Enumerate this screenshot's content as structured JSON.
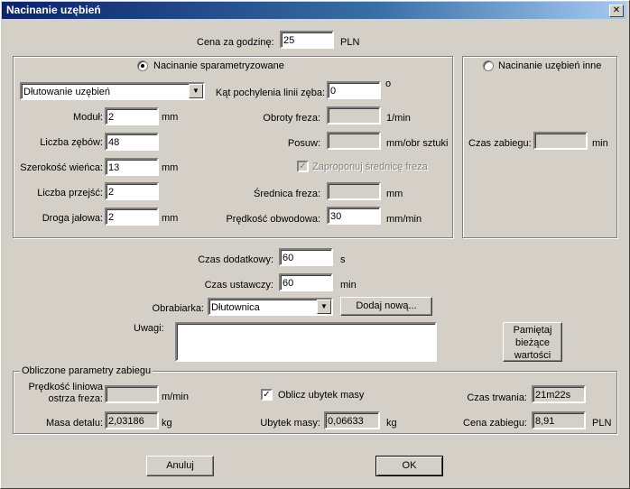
{
  "window": {
    "title": "Nacinanie uzębień",
    "close_glyph": "✕"
  },
  "top": {
    "cena_label": "Cena za godzinę:",
    "cena_value": "25",
    "cena_unit": "PLN"
  },
  "param": {
    "radio_label": "Nacinanie sparametryzowane",
    "method_value": "Dłutowanie uzębień",
    "modul_label": "Moduł:",
    "modul_value": "2",
    "modul_unit": "mm",
    "zebow_label": "Liczba zębów:",
    "zebow_value": "48",
    "szer_label": "Szerokość wieńca:",
    "szer_value": "13",
    "szer_unit": "mm",
    "przejsc_label": "Liczba przejść:",
    "przejsc_value": "2",
    "droga_label": "Droga jałowa:",
    "droga_value": "2",
    "droga_unit": "mm",
    "kat_label": "Kąt pochylenia linii zęba:",
    "kat_value": "0",
    "kat_unit": "o",
    "obroty_label": "Obroty freza:",
    "obroty_unit": "1/min",
    "posuw_label": "Posuw:",
    "posuw_unit": "mm/obr sztuki",
    "zaproponuj_label": "Zaproponuj średnicę freza",
    "srednica_label": "Średnica freza:",
    "srednica_unit": "mm",
    "predkosc_label": "Prędkość obwodowa:",
    "predkosc_value": "30",
    "predkosc_unit": "mm/min"
  },
  "inne": {
    "radio_label": "Nacinanie uzębień inne",
    "czas_label": "Czas zabiegu:",
    "czas_unit": "min"
  },
  "middle": {
    "dodatkowy_label": "Czas dodatkowy:",
    "dodatkowy_value": "60",
    "dodatkowy_unit": "s",
    "ustawczy_label": "Czas ustawczy:",
    "ustawczy_value": "60",
    "ustawczy_unit": "min",
    "obrabiarka_label": "Obrabiarka:",
    "obrabiarka_value": "Dłutownica",
    "dodaj_label": "Dodaj nową...",
    "uwagi_label": "Uwagi:",
    "pamietaj_line1": "Pamiętaj",
    "pamietaj_line2": "bieżące",
    "pamietaj_line3": "wartości"
  },
  "results": {
    "group_title": "Obliczone parametry zabiegu",
    "predkosc_line1": "Prędkość liniowa",
    "predkosc_line2": "ostrza freza:",
    "predkosc_unit": "m/min",
    "masa_label": "Masa detalu:",
    "masa_value": "2,03186",
    "masa_unit": "kg",
    "oblicz_label": "Oblicz ubytek masy",
    "ubytek_label": "Ubytek masy:",
    "ubytek_value": "0,06633",
    "ubytek_unit": "kg",
    "czas_label": "Czas trwania:",
    "czas_value": "21m22s",
    "cena_label": "Cena zabiegu:",
    "cena_value": "8,91",
    "cena_unit": "PLN"
  },
  "buttons": {
    "cancel": "Anuluj",
    "ok": "OK"
  }
}
